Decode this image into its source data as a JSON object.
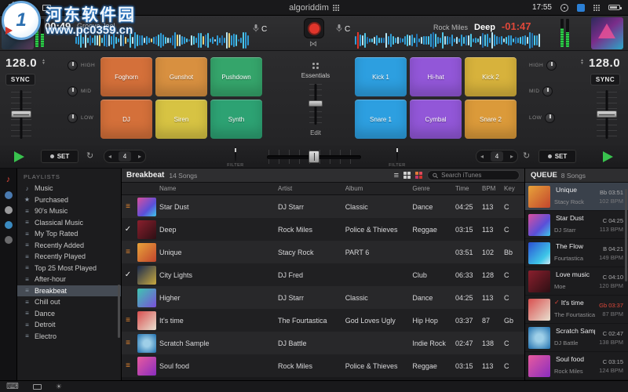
{
  "watermark": {
    "site_name": "河东软件园",
    "site_url": "www.pc0359.cn",
    "badge_text": "1"
  },
  "menubar": {
    "app_logo_text": "algoriddim",
    "time": "17:55"
  },
  "icons": {
    "music_note": "♪",
    "reorder": "≡",
    "check": "✓",
    "loop": "↻",
    "keyboard": "⌨",
    "brightness": "☀",
    "automix": "⋈",
    "prev": "◂",
    "next": "▸",
    "step_up": "▲",
    "step_down": "▼"
  },
  "deck_left": {
    "elapsed": "00:49",
    "title": "Groove Joel",
    "key": "C"
  },
  "deck_right": {
    "artist": "Rock Miles",
    "title": "Deep",
    "remaining": "-01:47",
    "key": "C"
  },
  "mixer_left": {
    "bpm": "128.0",
    "sync_label": "SYNC",
    "eq_labels": [
      "HIGH",
      "MID",
      "LOW"
    ]
  },
  "mixer_right": {
    "bpm": "128.0",
    "sync_label": "SYNC",
    "eq_labels": [
      "HIGH",
      "MID",
      "LOW"
    ]
  },
  "pads_left": [
    {
      "label": "Foghorn",
      "color": "#d4703a"
    },
    {
      "label": "Gunshot",
      "color": "#d89040"
    },
    {
      "label": "Pushdown",
      "color": "#35a56b"
    },
    {
      "label": "DJ",
      "color": "#d4703a"
    },
    {
      "label": "Siren",
      "color": "#d7c343"
    },
    {
      "label": "Synth",
      "color": "#2da273"
    }
  ],
  "pads_right": [
    {
      "label": "Kick 1",
      "color": "#2d9fe0"
    },
    {
      "label": "Hi-hat",
      "color": "#9257d8"
    },
    {
      "label": "Kick 2",
      "color": "#d7b23c"
    },
    {
      "label": "Snare 1",
      "color": "#2d9fe0"
    },
    {
      "label": "Cymbal",
      "color": "#9257d8"
    },
    {
      "label": "Snare 2",
      "color": "#db9a3a"
    }
  ],
  "sampler": {
    "pack_name": "Essentials",
    "edit_label": "Edit"
  },
  "transport": {
    "set_label": "SET",
    "loop_left": "4",
    "loop_right": "4",
    "filter_label": "FILTER"
  },
  "source_rail": {
    "icons": [
      {
        "name": "music",
        "color": "#e0483a"
      },
      {
        "name": "source-2",
        "color": "#4a7ab0"
      },
      {
        "name": "source-3",
        "color": "#9a9a9c"
      },
      {
        "name": "source-4",
        "color": "#3a8ac0"
      },
      {
        "name": "source-5",
        "color": "#6a6a6c"
      }
    ]
  },
  "sidebar": {
    "heading": "PLAYLISTS",
    "items": [
      {
        "label": "Music",
        "icon": "♪"
      },
      {
        "label": "Purchased",
        "icon": "★"
      },
      {
        "label": "90's Music",
        "icon": "≡"
      },
      {
        "label": "Classical Music",
        "icon": "≡"
      },
      {
        "label": "My Top Rated",
        "icon": "≡"
      },
      {
        "label": "Recently Added",
        "icon": "≡"
      },
      {
        "label": "Recently Played",
        "icon": "≡"
      },
      {
        "label": "Top 25 Most Played",
        "icon": "≡"
      },
      {
        "label": "After-hour",
        "icon": "≡"
      },
      {
        "label": "Breakbeat",
        "icon": "≡",
        "selected": true
      },
      {
        "label": "Chill out",
        "icon": "≡"
      },
      {
        "label": "Dance",
        "icon": "≡"
      },
      {
        "label": "Detroit",
        "icon": "≡"
      },
      {
        "label": "Electro",
        "icon": "≡"
      }
    ]
  },
  "library": {
    "title": "Breakbeat",
    "count": "14 Songs",
    "search_placeholder": "Search iTunes",
    "columns": [
      "Name",
      "Artist",
      "Album",
      "Genre",
      "Time",
      "BPM",
      "Key"
    ],
    "rows": [
      {
        "marker": {
          "glyph": "≡",
          "color": "#e0832f"
        },
        "name": "Star Dust",
        "artist": "DJ Starr",
        "album": "Classic",
        "genre": "Dance",
        "time": "04:25",
        "bpm": "113",
        "key": "C"
      },
      {
        "marker": {
          "glyph": "✓",
          "color": "#e8e8e8"
        },
        "name": "Deep",
        "artist": "Rock Miles",
        "album": "Police & Thieves",
        "genre": "Reggae",
        "time": "03:15",
        "bpm": "113",
        "key": "C"
      },
      {
        "marker": {
          "glyph": "≡",
          "color": "#e0832f"
        },
        "name": "Unique",
        "artist": "Stacy Rock",
        "album": "PART 6",
        "genre": "",
        "time": "03:51",
        "bpm": "102",
        "key": "Bb"
      },
      {
        "marker": {
          "glyph": "✓",
          "color": "#e8e8e8"
        },
        "name": "City Lights",
        "artist": "DJ Fred",
        "album": "",
        "genre": "Club",
        "time": "06:33",
        "bpm": "128",
        "key": "C"
      },
      {
        "marker": {
          "glyph": "",
          "color": ""
        },
        "name": "Higher",
        "artist": "DJ Starr",
        "album": "Classic",
        "genre": "Dance",
        "time": "04:25",
        "bpm": "113",
        "key": "C"
      },
      {
        "marker": {
          "glyph": "≡",
          "color": "#e0832f"
        },
        "name": "It's time",
        "artist": "The Fourtastica",
        "album": "God Loves Ugly",
        "genre": "Hip Hop",
        "time": "03:37",
        "bpm": "87",
        "key": "Gb"
      },
      {
        "marker": {
          "glyph": "≡",
          "color": "#e0832f"
        },
        "name": "Scratch Sample",
        "artist": "DJ Battle",
        "album": "",
        "genre": "Indie Rock",
        "time": "02:47",
        "bpm": "138",
        "key": "C"
      },
      {
        "marker": {
          "glyph": "≡",
          "color": "#e0832f"
        },
        "name": "Soul food",
        "artist": "Rock Miles",
        "album": "Police & Thieves",
        "genre": "Reggae",
        "time": "03:15",
        "bpm": "113",
        "key": "C"
      }
    ]
  },
  "queue": {
    "title": "QUEUE",
    "count": "8 Songs",
    "items": [
      {
        "title": "Unique",
        "artist": "Stacy Rock",
        "key_time": "Bb 03:51",
        "bpm": "102 BPM",
        "selected": true
      },
      {
        "title": "Star Dust",
        "artist": "DJ Starr",
        "key_time": "C 04:25",
        "bpm": "113 BPM"
      },
      {
        "title": "The Flow",
        "artist": "Fourtastica",
        "key_time": "B 04:21",
        "bpm": "149 BPM"
      },
      {
        "title": "Love music",
        "artist": "Moe",
        "key_time": "C 04:10",
        "bpm": "120 BPM"
      },
      {
        "title": "It's time",
        "artist": "The Fourtastica",
        "key_time": "Gb 03:37",
        "bpm": "87 BPM",
        "check": "✓",
        "played": true
      },
      {
        "title": "Scratch Sample",
        "artist": "DJ Battle",
        "key_time": "C 02:47",
        "bpm": "138 BPM"
      },
      {
        "title": "Soul food",
        "artist": "Rock Miles",
        "key_time": "C 03:15",
        "bpm": "124 BPM"
      }
    ]
  }
}
